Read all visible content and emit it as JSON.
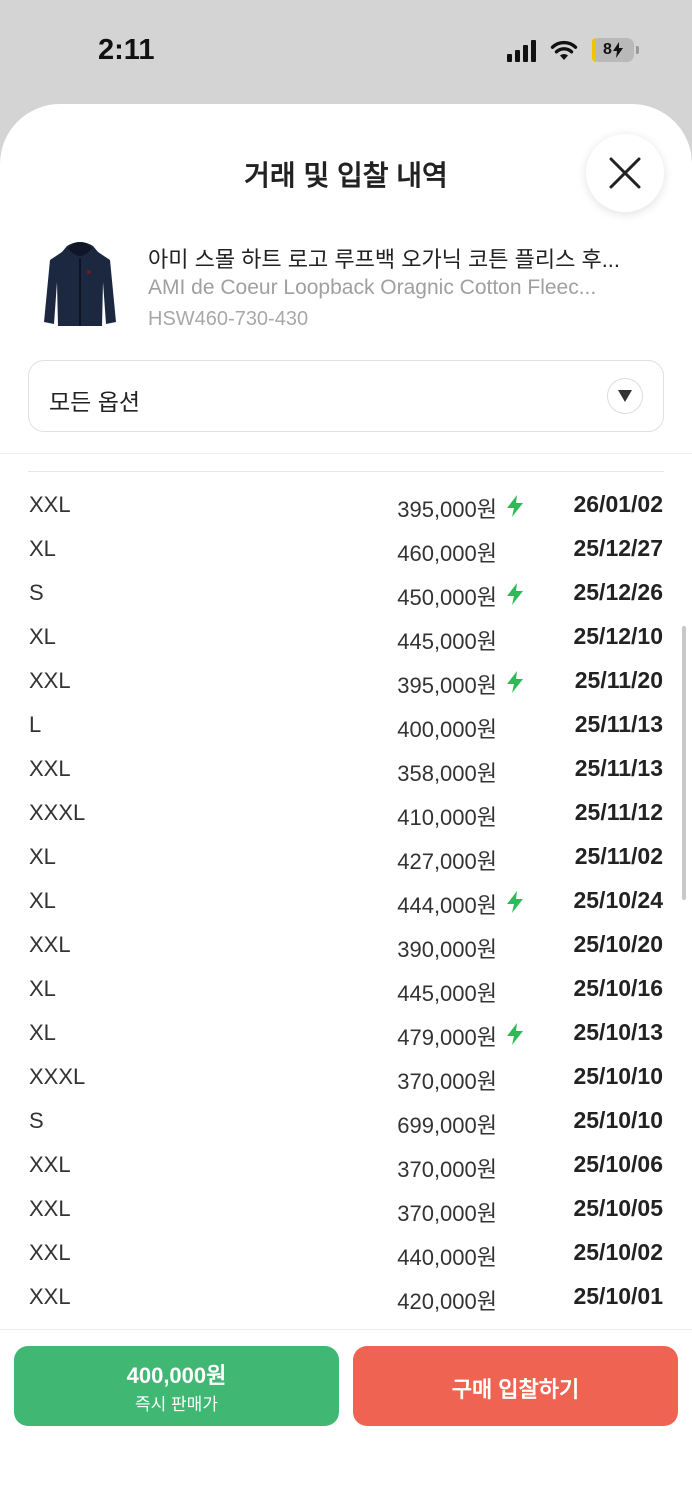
{
  "status_bar": {
    "time": "2:11",
    "battery": "8"
  },
  "sheet": {
    "title": "거래 및 입찰 내역"
  },
  "product": {
    "name": "아미 스몰 하트 로고 루프백 오가닉 코튼 플리스 후...",
    "name_en": "AMI de Coeur Loopback Oragnic Cotton Fleec...",
    "code": "HSW460-730-430"
  },
  "option_select": {
    "value": "모든 옵션"
  },
  "trades": [
    {
      "size": "XXL",
      "price": "395,000원",
      "bolt": true,
      "date": "26/01/02"
    },
    {
      "size": "XL",
      "price": "460,000원",
      "bolt": false,
      "date": "25/12/27"
    },
    {
      "size": "S",
      "price": "450,000원",
      "bolt": true,
      "date": "25/12/26"
    },
    {
      "size": "XL",
      "price": "445,000원",
      "bolt": false,
      "date": "25/12/10"
    },
    {
      "size": "XXL",
      "price": "395,000원",
      "bolt": true,
      "date": "25/11/20"
    },
    {
      "size": "L",
      "price": "400,000원",
      "bolt": false,
      "date": "25/11/13"
    },
    {
      "size": "XXL",
      "price": "358,000원",
      "bolt": false,
      "date": "25/11/13"
    },
    {
      "size": "XXXL",
      "price": "410,000원",
      "bolt": false,
      "date": "25/11/12"
    },
    {
      "size": "XL",
      "price": "427,000원",
      "bolt": false,
      "date": "25/11/02"
    },
    {
      "size": "XL",
      "price": "444,000원",
      "bolt": true,
      "date": "25/10/24"
    },
    {
      "size": "XXL",
      "price": "390,000원",
      "bolt": false,
      "date": "25/10/20"
    },
    {
      "size": "XL",
      "price": "445,000원",
      "bolt": false,
      "date": "25/10/16"
    },
    {
      "size": "XL",
      "price": "479,000원",
      "bolt": true,
      "date": "25/10/13"
    },
    {
      "size": "XXXL",
      "price": "370,000원",
      "bolt": false,
      "date": "25/10/10"
    },
    {
      "size": "S",
      "price": "699,000원",
      "bolt": false,
      "date": "25/10/10"
    },
    {
      "size": "XXL",
      "price": "370,000원",
      "bolt": false,
      "date": "25/10/06"
    },
    {
      "size": "XXL",
      "price": "370,000원",
      "bolt": false,
      "date": "25/10/05"
    },
    {
      "size": "XXL",
      "price": "440,000원",
      "bolt": false,
      "date": "25/10/02"
    },
    {
      "size": "XXL",
      "price": "420,000원",
      "bolt": false,
      "date": "25/10/01"
    }
  ],
  "bottom": {
    "sell_price": "400,000원",
    "sell_label": "즉시 판매가",
    "bid_label": "구매 입찰하기"
  },
  "colors": {
    "sell": "#40b874",
    "bid": "#ef6352",
    "bolt": "#2fba58"
  },
  "icons": {
    "close": "close-icon",
    "dropdown": "dropdown-triangle-icon",
    "bolt": "lightning-bolt-icon"
  }
}
